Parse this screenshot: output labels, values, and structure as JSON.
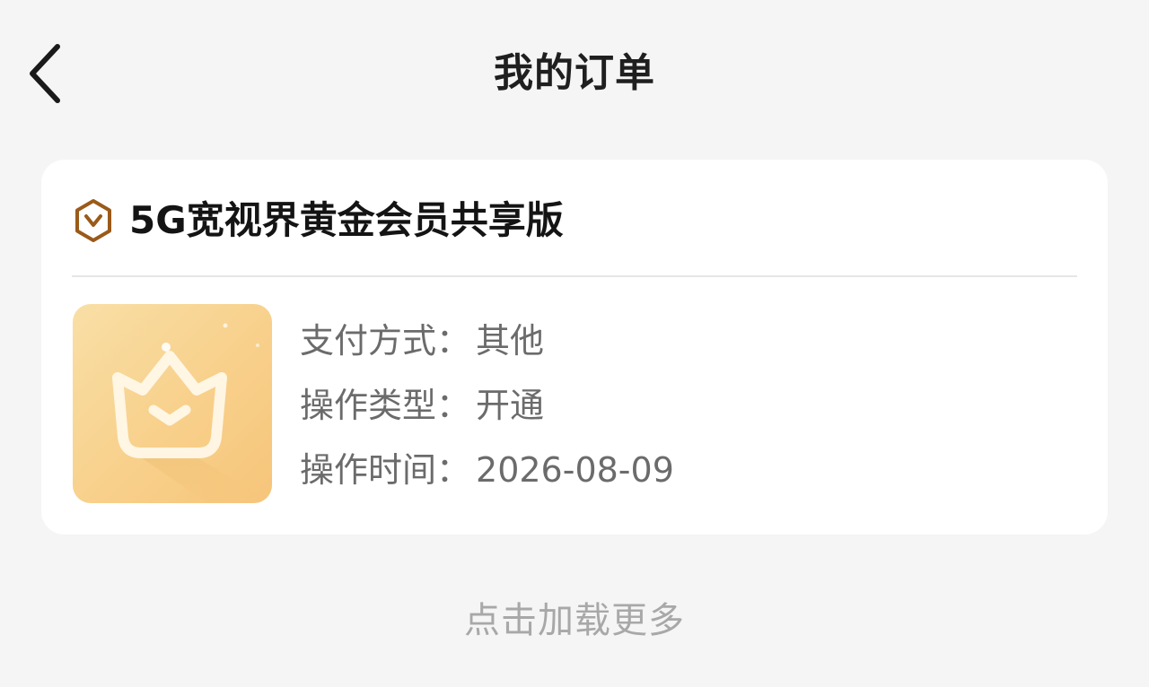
{
  "header": {
    "title": "我的订单",
    "back_icon": "chevron-left-icon"
  },
  "order": {
    "badge_icon": "vip-v-hexagon-icon",
    "badge_color": "#9a5a19",
    "product_name": "5G宽视界黄金会员共享版",
    "thumbnail_icon": "crown-icon",
    "details": [
      {
        "label": "支付方式",
        "separator": "：",
        "value": "其他"
      },
      {
        "label": "操作类型",
        "separator": "：",
        "value": "开通"
      },
      {
        "label": "操作时间",
        "separator": "：",
        "value": "2026-08-09"
      }
    ]
  },
  "footer": {
    "load_more": "点击加载更多"
  },
  "colors": {
    "background": "#f5f5f5",
    "card": "#ffffff",
    "text_primary": "#141414",
    "text_secondary": "#6b6b6b",
    "text_muted": "#a8a8a8",
    "thumb_gold": "#f8d08b"
  }
}
